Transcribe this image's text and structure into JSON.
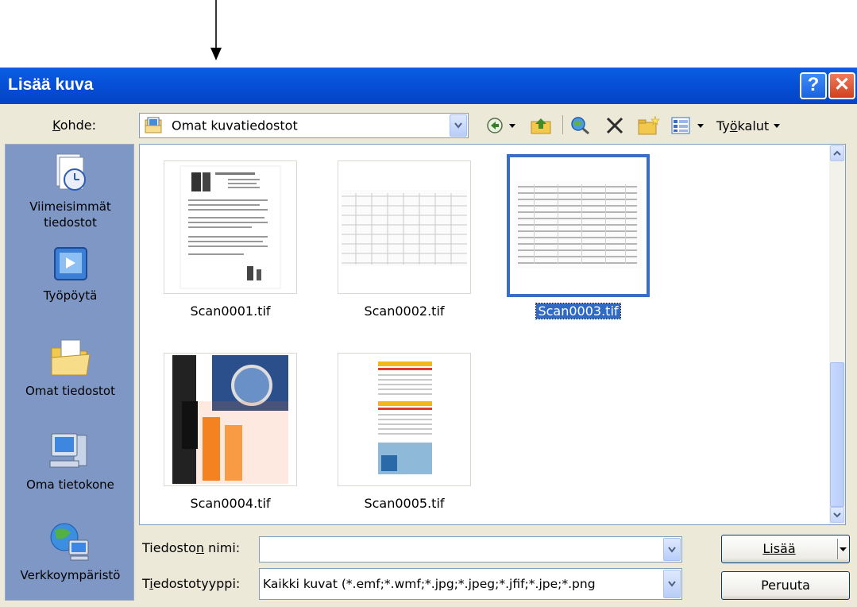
{
  "dialog": {
    "title": "Lisää kuva",
    "help_button": "?",
    "close_button": "✕"
  },
  "lookin": {
    "label_pre": "",
    "label_u": "K",
    "label_post": "ohde:",
    "value": "Omat kuvatiedostot"
  },
  "toolbar": {
    "tools_pre": "Ty",
    "tools_u": "ö",
    "tools_post": "kalut"
  },
  "places": [
    {
      "label_line1": "Viimeisimmät",
      "label_line2": "tiedostot",
      "icon": "recent-documents-icon"
    },
    {
      "label_line1": "Työpöytä",
      "label_line2": "",
      "icon": "desktop-icon"
    },
    {
      "label_line1": "Omat tiedostot",
      "label_line2": "",
      "icon": "my-documents-folder-icon"
    },
    {
      "label_line1": "Oma tietokone",
      "label_line2": "",
      "icon": "my-computer-icon"
    },
    {
      "label_line1": "Verkkoympäristö",
      "label_line2": "",
      "icon": "network-places-icon"
    }
  ],
  "files": [
    {
      "name": "Scan0001.tif",
      "selected": false
    },
    {
      "name": "Scan0002.tif",
      "selected": false
    },
    {
      "name": "Scan0003.tif",
      "selected": true
    },
    {
      "name": "Scan0004.tif",
      "selected": false
    },
    {
      "name": "Scan0005.tif",
      "selected": false
    }
  ],
  "filename": {
    "label_pre": "Tiedosto",
    "label_u": "n",
    "label_post": " nimi:",
    "value": ""
  },
  "filetype": {
    "label_pre": "T",
    "label_u": "i",
    "label_post": "edostotyyppi:",
    "value": "Kaikki kuvat (*.emf;*.wmf;*.jpg;*.jpeg;*.jfif;*.jpe;*.png"
  },
  "buttons": {
    "insert_u": "L",
    "insert_post": "isää",
    "cancel": "Peruuta"
  },
  "colors": {
    "title_bar": "#0650d8",
    "places_bar": "#7f97c5",
    "selection": "#316ac5",
    "dialog_bg": "#ece9d8"
  }
}
